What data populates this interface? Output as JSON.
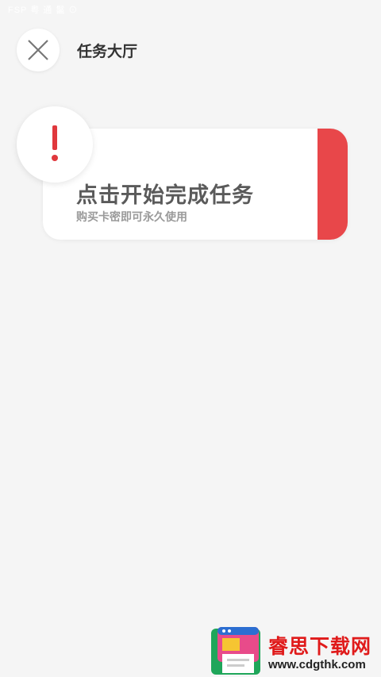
{
  "status_bar": {
    "text": "FSP 粤 通 鬣 ⊙"
  },
  "header": {
    "title": "任务大厅",
    "close_icon": "close-icon"
  },
  "task_card": {
    "title": "点击开始完成任务",
    "subtitle": "购买卡密即可永久使用",
    "alert_icon": "exclamation-icon",
    "accent_color": "#e8474a"
  },
  "watermark": {
    "name": "睿思下载网",
    "url": "www.cdgthk.com",
    "logo_icon": "browser-window-icon"
  }
}
